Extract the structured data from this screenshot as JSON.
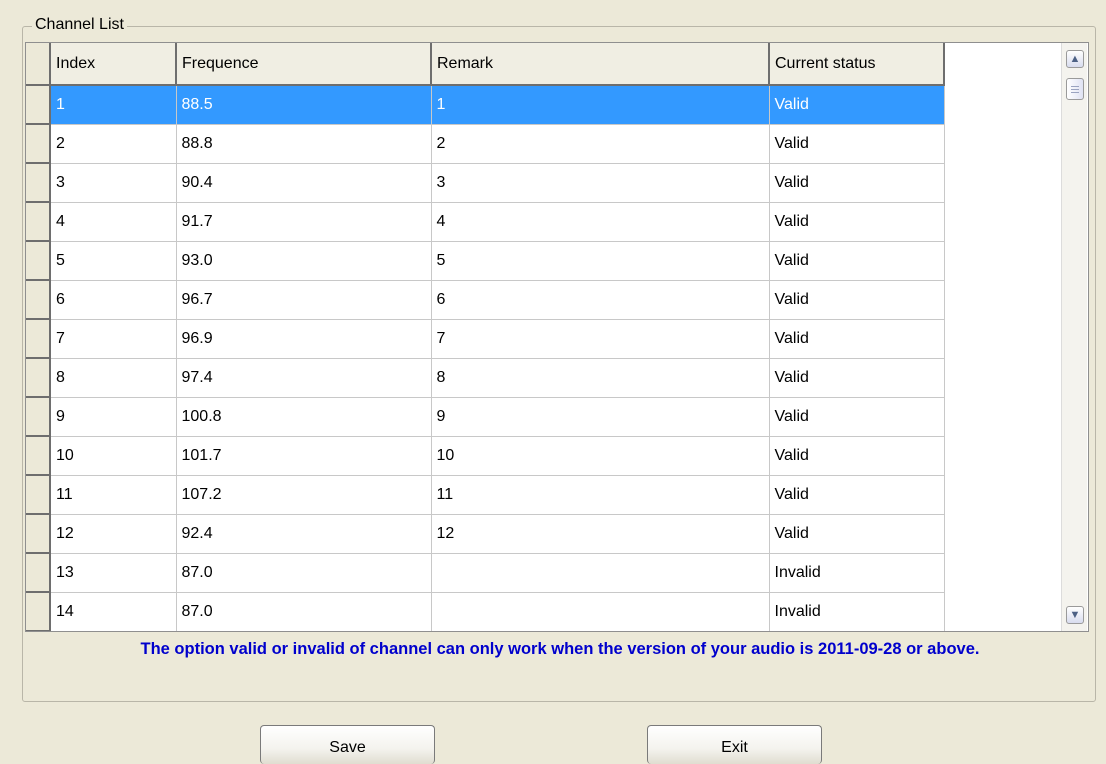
{
  "group_title": "Channel List",
  "columns": [
    "Index",
    "Frequence",
    "Remark",
    "Current status"
  ],
  "rows": [
    {
      "index": "1",
      "frequence": "88.5",
      "remark": "1",
      "status": "Valid"
    },
    {
      "index": "2",
      "frequence": "88.8",
      "remark": "2",
      "status": "Valid"
    },
    {
      "index": "3",
      "frequence": "90.4",
      "remark": "3",
      "status": "Valid"
    },
    {
      "index": "4",
      "frequence": "91.7",
      "remark": "4",
      "status": "Valid"
    },
    {
      "index": "5",
      "frequence": "93.0",
      "remark": "5",
      "status": "Valid"
    },
    {
      "index": "6",
      "frequence": "96.7",
      "remark": "6",
      "status": "Valid"
    },
    {
      "index": "7",
      "frequence": "96.9",
      "remark": "7",
      "status": "Valid"
    },
    {
      "index": "8",
      "frequence": "97.4",
      "remark": "8",
      "status": "Valid"
    },
    {
      "index": "9",
      "frequence": "100.8",
      "remark": "9",
      "status": "Valid"
    },
    {
      "index": "10",
      "frequence": "101.7",
      "remark": "10",
      "status": "Valid"
    },
    {
      "index": "11",
      "frequence": "107.2",
      "remark": "11",
      "status": "Valid"
    },
    {
      "index": "12",
      "frequence": "92.4",
      "remark": "12",
      "status": "Valid"
    },
    {
      "index": "13",
      "frequence": "87.0",
      "remark": "",
      "status": "Invalid"
    },
    {
      "index": "14",
      "frequence": "87.0",
      "remark": "",
      "status": "Invalid"
    }
  ],
  "selected_row": 0,
  "note": "The option valid or invalid of channel can only work when the version of your audio is 2011-09-28 or above.",
  "buttons": {
    "save": "Save",
    "exit": "Exit"
  },
  "colors": {
    "selection": "#3399ff",
    "note_text": "#0000cc",
    "window_bg": "#ece9d8"
  },
  "icons": {
    "scroll_up": "chevron-up-icon",
    "scroll_down": "chevron-down-icon"
  }
}
